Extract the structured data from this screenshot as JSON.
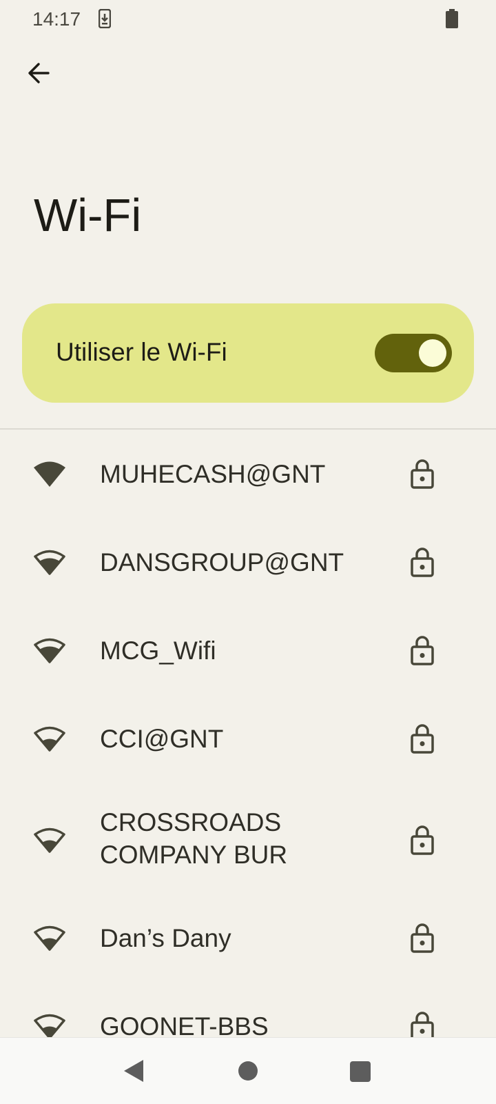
{
  "status": {
    "time": "14:17"
  },
  "header": {
    "title": "Wi-Fi"
  },
  "toggle": {
    "label": "Utiliser le Wi-Fi",
    "enabled": true
  },
  "networks": [
    {
      "name": "MUHECASH@GNT",
      "signal": "full",
      "secured": true
    },
    {
      "name": "DANSGROUP@GNT",
      "signal": "medium",
      "secured": true
    },
    {
      "name": "MCG_Wifi",
      "signal": "medium",
      "secured": true
    },
    {
      "name": "CCI@GNT",
      "signal": "low",
      "secured": true
    },
    {
      "name": "CROSSROADS\nCOMPANY BUR",
      "signal": "low",
      "secured": true
    },
    {
      "name": "Dan’s Dany",
      "signal": "low",
      "secured": true
    },
    {
      "name": "GOONET-BBS",
      "signal": "low",
      "secured": true
    }
  ],
  "colors": {
    "accent": "#62620c",
    "card": "#e3e78a",
    "background": "#f3f1ea"
  }
}
